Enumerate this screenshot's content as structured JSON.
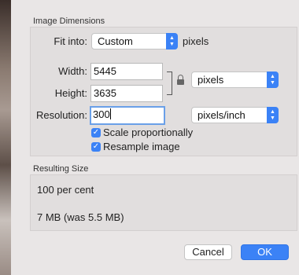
{
  "image_dimensions": {
    "title": "Image Dimensions",
    "fit_into": {
      "label": "Fit into:",
      "value": "Custom",
      "unit": "pixels"
    },
    "width": {
      "label": "Width:",
      "value": "5445"
    },
    "height": {
      "label": "Height:",
      "value": "3635"
    },
    "size_unit": "pixels",
    "resolution": {
      "label": "Resolution:",
      "value": "300",
      "unit": "pixels/inch"
    },
    "scale_proportionally": {
      "label": "Scale proportionally",
      "checked": true
    },
    "resample_image": {
      "label": "Resample image",
      "checked": true
    }
  },
  "resulting_size": {
    "title": "Resulting Size",
    "percent": "100 per cent",
    "size": "7 MB (was 5.5 MB)"
  },
  "buttons": {
    "cancel": "Cancel",
    "ok": "OK"
  },
  "colors": {
    "accent": "#3b82f6",
    "sheet": "#e9e6e6"
  }
}
